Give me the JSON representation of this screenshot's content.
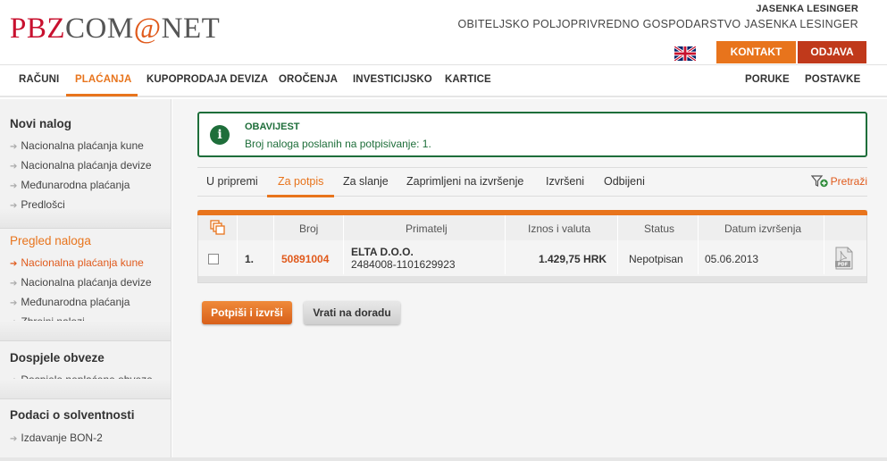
{
  "logo": {
    "part1": "PBZ",
    "part2": "COM",
    "part3": "@",
    "part4": "NET"
  },
  "user": {
    "name": "JASENKA LESINGER",
    "organization": "OBITELJSKO POLJOPRIVREDNO GOSPODARSTVO JASENKA LESINGER"
  },
  "header_buttons": {
    "contact": "KONTAKT",
    "logout": "ODJAVA"
  },
  "language_icon": "uk-flag-icon",
  "topnav": {
    "items": [
      "RAČUNI",
      "PLAĆANJA",
      "KUPOPRODAJA DEVIZA",
      "OROČENJA",
      "INVESTICIJSKO",
      "KARTICE"
    ],
    "right_items": [
      "PORUKE",
      "POSTAVKE"
    ],
    "active": "PLAĆANJA"
  },
  "sidebar": {
    "sections": [
      {
        "title": "Novi nalog",
        "items": [
          "Nacionalna plaćanja kune",
          "Nacionalna plaćanja devize",
          "Međunarodna plaćanja",
          "Predlošci"
        ]
      },
      {
        "title": "Pregled naloga",
        "items": [
          "Nacionalna plaćanja kune",
          "Nacionalna plaćanja devize",
          "Međunarodna plaćanja",
          "Zbrojni nalozi"
        ],
        "active_item": "Nacionalna plaćanja kune"
      },
      {
        "title": "Dospjele obveze",
        "items": [
          "Dospjele neplaćene obveze"
        ]
      },
      {
        "title": "Podaci o solventnosti",
        "items": [
          "Izdavanje BON-2"
        ]
      }
    ]
  },
  "notice": {
    "icon": "info-icon",
    "title": "OBAVIJEST",
    "message": "Broj naloga poslanih na potpisivanje: 1."
  },
  "tabs": {
    "items": [
      "U pripremi",
      "Za potpis",
      "Za slanje",
      "Zaprimljeni na izvršenje",
      "Izvršeni",
      "Odbijeni"
    ],
    "active": "Za potpis",
    "search_label": "Pretraži"
  },
  "table": {
    "columns": [
      "Broj",
      "Primatelj",
      "Iznos i valuta",
      "Status",
      "Datum izvršenja"
    ],
    "rows": [
      {
        "index": "1.",
        "number": "50891004",
        "recipient_name": "ELTA D.O.O.",
        "recipient_account": "2484008-1101629923",
        "amount": "1.429,75 HRK",
        "status": "Nepotpisan",
        "date": "05.06.2013"
      }
    ]
  },
  "actions": {
    "sign": "Potpiši i izvrši",
    "return": "Vrati na doradu"
  },
  "colors": {
    "accent": "#e8741c",
    "logout": "#c0391b",
    "notice_green": "#1e6e3a",
    "brand_red": "#c8102e"
  }
}
